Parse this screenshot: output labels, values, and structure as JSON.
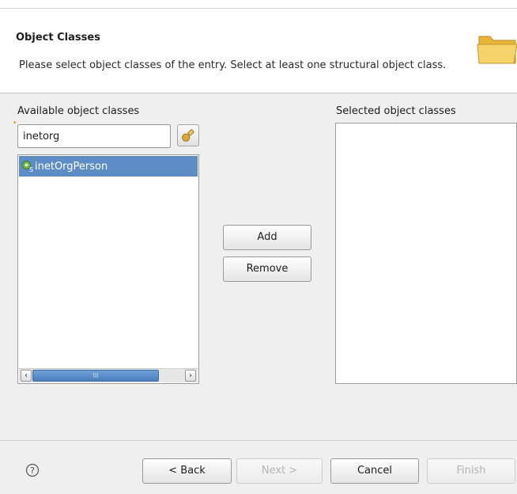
{
  "header": {
    "title": "Object Classes",
    "description": "Please select object classes of the entry. Select at least one structural object class."
  },
  "available": {
    "label": "Available object classes",
    "filter_value": "inetorg",
    "items": [
      {
        "label": "inetOrgPerson",
        "selected": true
      }
    ],
    "scrollbar_grip": "III"
  },
  "selected": {
    "label": "Selected object classes",
    "items": []
  },
  "actions": {
    "add_label": "Add",
    "remove_label": "Remove"
  },
  "footer": {
    "back_label": "< Back",
    "next_label": "Next >",
    "cancel_label": "Cancel",
    "finish_label": "Finish"
  },
  "colors": {
    "selection": "#5d8dc4",
    "folder": "#f2c44d"
  },
  "icons": {
    "header": "folder-icon",
    "browse": "browse-icon",
    "item": "object-class-icon",
    "help": "help-icon"
  }
}
